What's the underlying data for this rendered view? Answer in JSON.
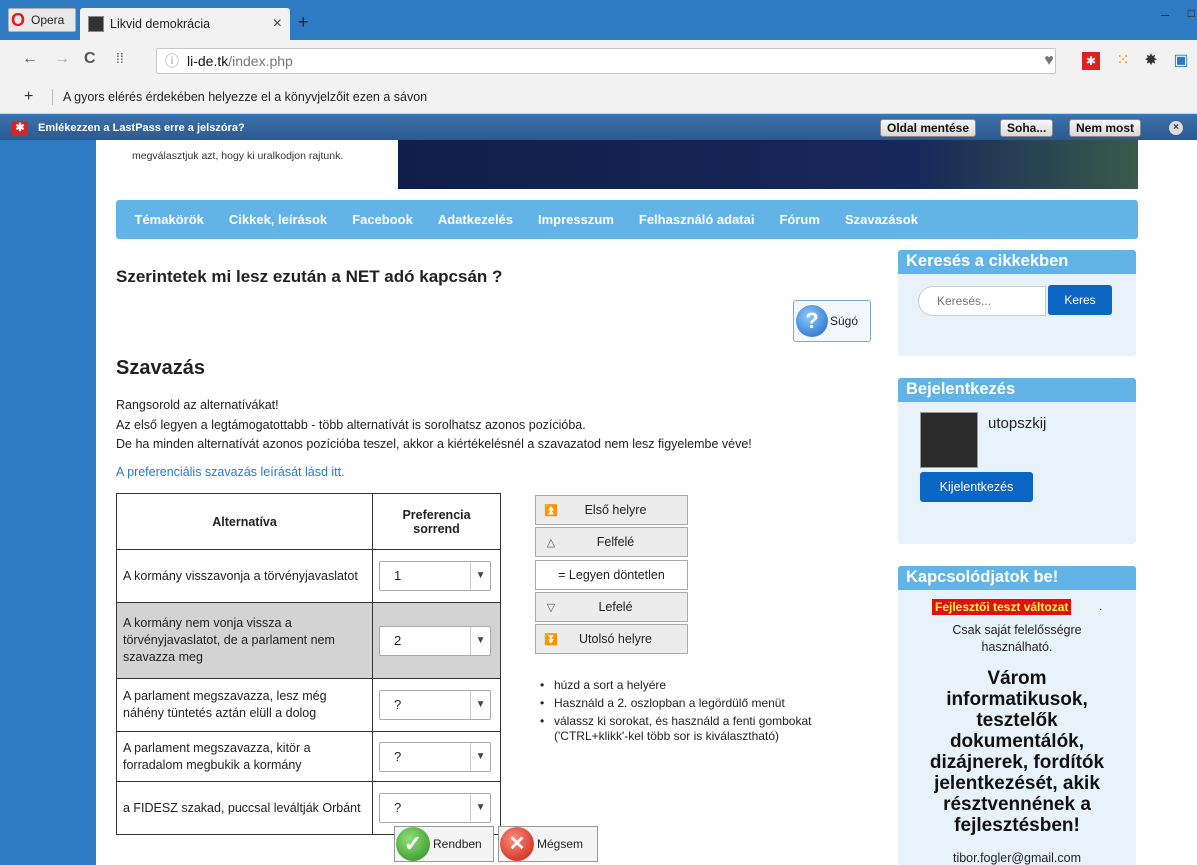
{
  "browser": {
    "opera_label": "Opera",
    "tab_title": "Likvid demokrácia",
    "tab_close": "×",
    "new_tab": "+",
    "url_host": "li-de.tk",
    "url_path": "/index.php",
    "bookmark_plus": "+",
    "bookmark_hint": "A gyors elérés érdekében helyezze el a könyvjelzőit ezen a sávon"
  },
  "lastpass": {
    "prompt": "Emlékezzen a LastPass erre a jelszóra?",
    "save_label": "Oldal mentése",
    "never_label": "Soha...",
    "not_now_label": "Nem most"
  },
  "header": {
    "tagline": "megválasztjuk azt, hogy ki uralkodjon rajtunk."
  },
  "menu": [
    "Témakörök",
    "Cikkek, leírások",
    "Facebook",
    "Adatkezelés",
    "Impresszum",
    "Felhasználó adatai",
    "Fórum",
    "Szavazások"
  ],
  "main": {
    "question": "Szerintetek mi lesz ezután a NET adó kapcsán ?",
    "help_label": "Súgó",
    "vote_title": "Szavazás",
    "instructions": [
      "Rangsorold az alternatívákat!",
      "Az első legyen a legtámogatottabb - több alternatívát is sorolhatsz azonos pozícióba.",
      "De ha minden alternatívát azonos pozícióba teszel, akkor a kiértékelésnél a szavazatod nem lesz figyelembe véve!"
    ],
    "pref_link": "A preferenciális szavazás leírását lásd itt.",
    "table": {
      "col_alt": "Alternatíva",
      "col_pref_line1": "Preferencia",
      "col_pref_line2": "sorrend",
      "rows": [
        {
          "alt": "A kormány visszavonja a törvényjavaslatot",
          "pref": "1"
        },
        {
          "alt": "A kormány nem vonja vissza a törvényjavaslatot, de a parlament nem szavazza meg",
          "pref": "2"
        },
        {
          "alt": "A parlament megszavazza, lesz még náhény tüntetés aztán elüll a dolog",
          "pref": "?"
        },
        {
          "alt": "A parlament megszavazza, kitör a forradalom megbukik a kormány",
          "pref": "?"
        },
        {
          "alt": "a FIDESZ szakad, puccsal leváltják Orbánt",
          "pref": "?"
        }
      ]
    },
    "controls": {
      "first": "Első helyre",
      "up": "Felfelé",
      "tie": "= Legyen döntetlen",
      "down": "Lefelé",
      "last": "Utolsó helyre"
    },
    "tips": [
      "húzd a sort a helyére",
      "Használd a 2. oszlopban a legördülő menüt",
      "válassz ki sorokat, és használd a fenti gombokat ('CTRL+klikk'-kel több sor is kiválasztható)"
    ],
    "ok_label": "Rendben",
    "cancel_label": "Mégsem"
  },
  "sidebar": {
    "search_title": "Keresés a cikkekben",
    "search_placeholder": "Keresés...",
    "search_button": "Keres",
    "login_title": "Bejelentkezés",
    "username": "utopszkij",
    "logout_button": "Kijelentkezés",
    "connect_title": "Kapcsolódjatok be!",
    "dev_warning": "Fejlesztői teszt változat",
    "dev_dot": ".",
    "dev_note": "Csak saját felelősségre használható.",
    "wanted": "Várom informatikusok, tesztelők dokumentálók, dizájnerek, fordítók jelentkezését, akik résztvennének a fejlesztésben!",
    "email": "tibor.fogler@gmail.com"
  },
  "colors": {
    "menu_bg": "#62b3e6",
    "primary_btn": "#0a66c2",
    "link": "#2a7ac8",
    "warning_bg": "#e01010",
    "warning_fg": "#ffff33"
  }
}
